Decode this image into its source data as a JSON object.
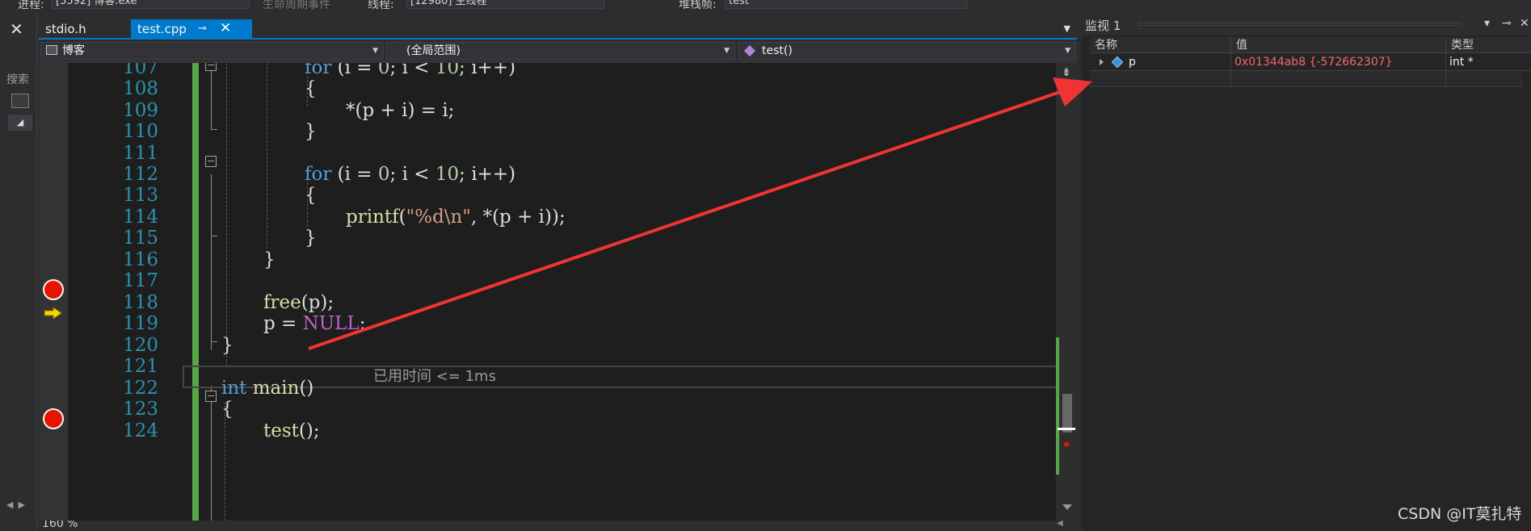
{
  "toolbar": {
    "process_label": "进程:",
    "process_value": "[5592] 博客.exe",
    "lifecycle_label": "生命周期事件",
    "thread_label": "线程:",
    "thread_value": "[12980] 主线程",
    "stack_label": "堆栈帧:",
    "stack_value": "test"
  },
  "left_strip": {
    "close": "✕",
    "search_label": "搜索"
  },
  "tabs": [
    {
      "label": "stdio.h",
      "active": false
    },
    {
      "label": "test.cpp",
      "active": true,
      "pin": "⊸",
      "close": "✕"
    }
  ],
  "nav": {
    "project": "博客",
    "scope": "(全局范围)",
    "member": "test()"
  },
  "editor": {
    "zoom": "160 %",
    "elapsed_hint": "已用时间 <= 1ms",
    "lines": [
      {
        "num": "107",
        "code": "for (i = 0; i < 10; i++)"
      },
      {
        "num": "108",
        "code": "{"
      },
      {
        "num": "109",
        "code": "*(p + i) = i;"
      },
      {
        "num": "110",
        "code": "}"
      },
      {
        "num": "111",
        "code": ""
      },
      {
        "num": "112",
        "code": "for (i = 0; i < 10; i++)"
      },
      {
        "num": "113",
        "code": "{"
      },
      {
        "num": "114",
        "code": "printf(\"%d\\n\", *(p + i));"
      },
      {
        "num": "115",
        "code": "}"
      },
      {
        "num": "116",
        "code": "}"
      },
      {
        "num": "117",
        "code": ""
      },
      {
        "num": "118",
        "code": "free(p);"
      },
      {
        "num": "119",
        "code": "p = NULL;"
      },
      {
        "num": "120",
        "code": "}"
      },
      {
        "num": "121",
        "code": ""
      },
      {
        "num": "122",
        "code": "int main()"
      },
      {
        "num": "123",
        "code": "{"
      },
      {
        "num": "124",
        "code": "test();"
      }
    ],
    "breakpoints": [
      "118",
      "124"
    ],
    "current_line": "119"
  },
  "code_tokens": {
    "for": "for",
    "open_init": " (i = ",
    "zero": "0",
    "semi_cond": "; i < ",
    "ten": "10",
    "inc": "; i++)",
    "brace_open": "{",
    "brace_close": "}",
    "assign_body": "*(p + i) = i;",
    "printf": "printf",
    "paren_open": "(",
    "fmt": "\"%d\\n\"",
    "printf_rest": ", *(p + i));",
    "free": "free",
    "free_rest": "(p);",
    "p_assign": "p = ",
    "null": "NULL",
    "semi": ";",
    "int": "int",
    "main": "main",
    "main_rest": "()",
    "test": "test",
    "test_rest": "();"
  },
  "watch": {
    "title": "监视 1",
    "pin": "⊸",
    "close": "✕",
    "dropdown": "▾",
    "columns": {
      "name": "名称",
      "value": "值",
      "type": "类型"
    },
    "rows": [
      {
        "name": "p",
        "value": "0x01344ab8 {-572662307}",
        "type": "int *"
      }
    ]
  },
  "watermark": "CSDN @IT莫扎特",
  "colors": {
    "accent": "#007acc",
    "breakpoint": "#e51400",
    "changed_value": "#f4676f",
    "annotation_arrow": "#f03434"
  }
}
